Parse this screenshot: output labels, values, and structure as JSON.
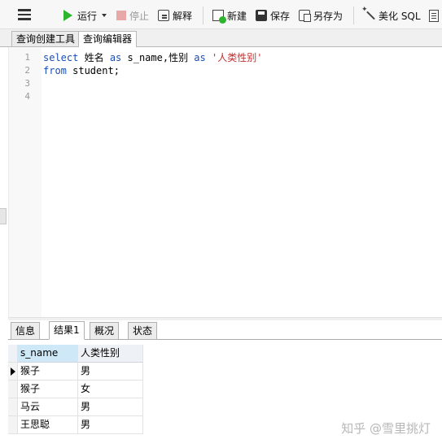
{
  "toolbar": {
    "run_label": "运行",
    "stop_label": "停止",
    "explain_label": "解释",
    "new_label": "新建",
    "save_label": "保存",
    "save_as_label": "另存为",
    "beautify_label": "美化 SQL"
  },
  "editor_tabs": [
    {
      "label": "查询创建工具"
    },
    {
      "label": "查询编辑器"
    }
  ],
  "editor": {
    "line_numbers": [
      "1",
      "2",
      "3",
      "4"
    ],
    "line1": {
      "kw_select": "select",
      "col1": " 姓名 ",
      "kw_as1": "as",
      "alias1": " s_name,性别 ",
      "kw_as2": "as",
      "alias2_str": " '人类性别'"
    },
    "line2": {
      "kw_from": "from",
      "table": " student;"
    }
  },
  "result_tabs": [
    {
      "label": "信息"
    },
    {
      "label": "结果1"
    },
    {
      "label": "概况"
    },
    {
      "label": "状态"
    }
  ],
  "result": {
    "columns": [
      "s_name",
      "人类性别"
    ],
    "rows": [
      [
        "猴子",
        "男"
      ],
      [
        "猴子",
        "女"
      ],
      [
        "马云",
        "男"
      ],
      [
        "王思聪",
        "男"
      ]
    ]
  },
  "watermark": "知乎 @雪里挑灯",
  "colors": {
    "keyword": "#1b4db5",
    "string": "#c03030",
    "run_icon": "#2db52d"
  }
}
